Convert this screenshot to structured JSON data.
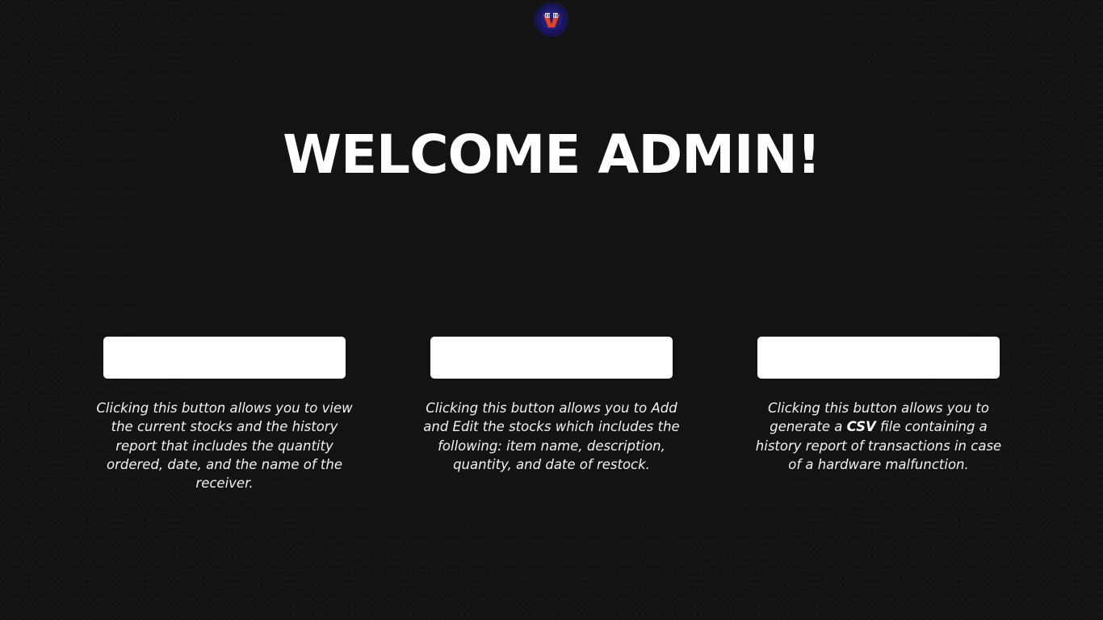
{
  "header": {
    "logo_icon": "school-seal-logo",
    "title": "WELCOME ADMIN!"
  },
  "cards": [
    {
      "button_label": "",
      "description": "Clicking this button allows you to view the current stocks and the history report that includes the quantity ordered, date, and the name of the receiver."
    },
    {
      "button_label": "",
      "description": "Clicking this button allows you to Add and Edit the stocks which includes the following: item name, description, quantity, and date of restock."
    },
    {
      "button_label": "",
      "description_before": "Clicking this button allows you to generate a",
      "description_bold": "CSV",
      "description_after": "file containing a history report of transactions in case of a hardware malfunction."
    }
  ],
  "colors": {
    "background": "#131313",
    "button": "#ffffff",
    "text": "#ffffff",
    "logo_ring": "#14124a",
    "logo_accent": "#e8431f"
  }
}
